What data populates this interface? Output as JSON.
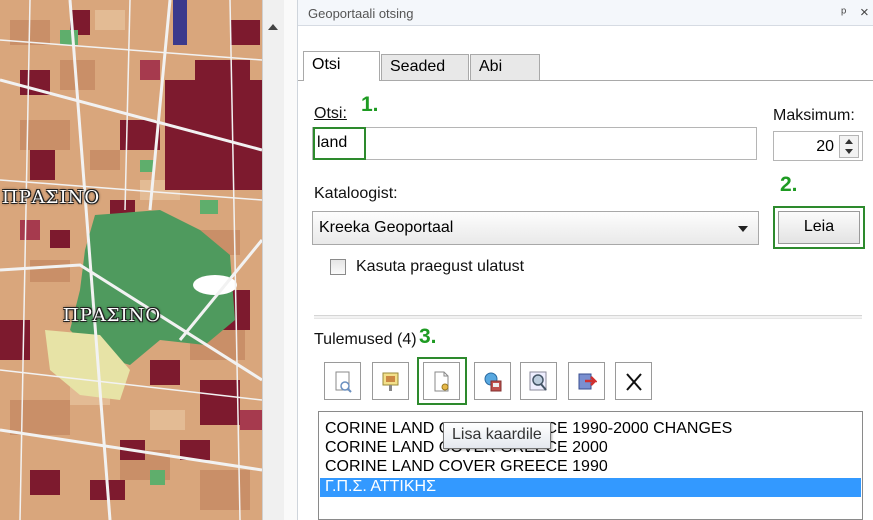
{
  "map": {
    "labels": [
      "ΠΡΑΣΙΝΟ",
      "ΠΡΑΣΙΝΟ"
    ]
  },
  "panel": {
    "title": "Geoportaali otsing",
    "pin_icon": "pin-icon",
    "close_icon": "close-icon",
    "pin_glyph": "ᵖ",
    "close_glyph": "×"
  },
  "tabs": [
    {
      "label": "Otsi",
      "active": true
    },
    {
      "label": "Seaded",
      "active": false
    },
    {
      "label": "Abi",
      "active": false
    }
  ],
  "search": {
    "label": "Otsi:",
    "value": "land",
    "step": "1."
  },
  "maximum": {
    "label": "Maksimum:",
    "value": "20"
  },
  "catalog": {
    "label": "Kataloogist:",
    "selected": "Kreeka Geoportaal",
    "step": "2."
  },
  "find_button": {
    "label": "Leia"
  },
  "use_extent": {
    "label": "Kasuta praegust ulatust",
    "checked": false
  },
  "results": {
    "label": "Tulemused (4)",
    "step": "3.",
    "toolbar": [
      "details-icon",
      "metadata-icon",
      "add-to-map-icon",
      "open-globe-icon",
      "zoom-extent-icon",
      "export-icon",
      "clear-icon"
    ],
    "items": [
      {
        "text": "CORINE LAND COVER GREECE 1990-2000 CHANGES",
        "selected": false
      },
      {
        "text": "CORINE LAND COVER GREECE 2000",
        "selected": false
      },
      {
        "text": "CORINE LAND COVER GREECE 1990",
        "selected": false
      },
      {
        "text": "Γ.Π.Σ. ΑΤΤΙΚΗΣ",
        "selected": true
      }
    ]
  },
  "tooltip": {
    "text": "Lisa kaardile"
  },
  "colors": {
    "accent_green": "#2d8a2d",
    "step_green": "#1e9b22",
    "selection": "#3399ff",
    "map_dense": "#7d1a2e",
    "map_park": "#4f9a5e",
    "map_base": "#d9a67c"
  }
}
